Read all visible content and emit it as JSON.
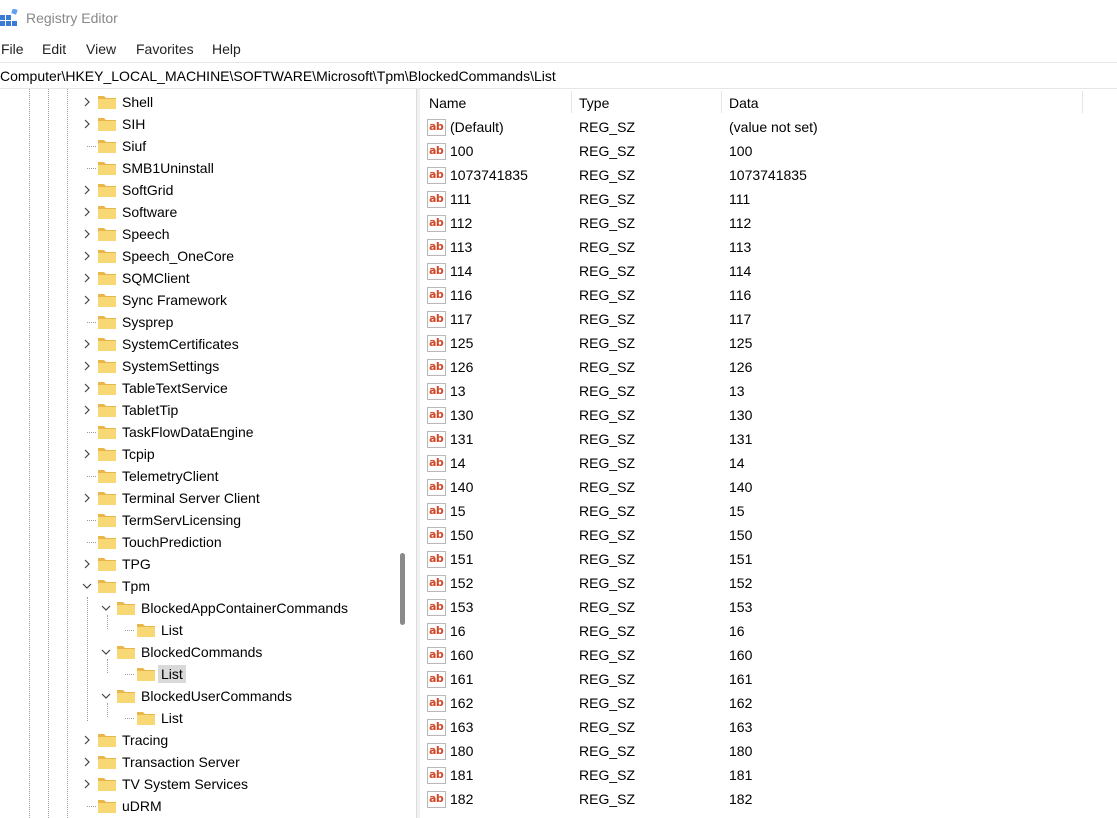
{
  "window": {
    "title": "Registry Editor"
  },
  "menu": [
    "File",
    "Edit",
    "View",
    "Favorites",
    "Help"
  ],
  "address": "Computer\\HKEY_LOCAL_MACHINE\\SOFTWARE\\Microsoft\\Tpm\\BlockedCommands\\List",
  "colors": {
    "folder": "#f8d775",
    "folder_dark": "#e8b64a",
    "ab_text": "#d24726",
    "selection": "#d9d9d9"
  },
  "tree": [
    {
      "label": "Shell",
      "chevron": "right"
    },
    {
      "label": "SIH",
      "chevron": "right"
    },
    {
      "label": "Siuf",
      "chevron": "none"
    },
    {
      "label": "SMB1Uninstall",
      "chevron": "none"
    },
    {
      "label": "SoftGrid",
      "chevron": "right"
    },
    {
      "label": "Software",
      "chevron": "right"
    },
    {
      "label": "Speech",
      "chevron": "right"
    },
    {
      "label": "Speech_OneCore",
      "chevron": "right"
    },
    {
      "label": "SQMClient",
      "chevron": "right"
    },
    {
      "label": "Sync Framework",
      "chevron": "right"
    },
    {
      "label": "Sysprep",
      "chevron": "none"
    },
    {
      "label": "SystemCertificates",
      "chevron": "right"
    },
    {
      "label": "SystemSettings",
      "chevron": "right"
    },
    {
      "label": "TableTextService",
      "chevron": "right"
    },
    {
      "label": "TabletTip",
      "chevron": "right"
    },
    {
      "label": "TaskFlowDataEngine",
      "chevron": "none"
    },
    {
      "label": "Tcpip",
      "chevron": "right"
    },
    {
      "label": "TelemetryClient",
      "chevron": "none"
    },
    {
      "label": "Terminal Server Client",
      "chevron": "right"
    },
    {
      "label": "TermServLicensing",
      "chevron": "none"
    },
    {
      "label": "TouchPrediction",
      "chevron": "none"
    },
    {
      "label": "TPG",
      "chevron": "right"
    },
    {
      "label": "Tpm",
      "chevron": "down"
    },
    {
      "label": "BlockedAppContainerCommands",
      "chevron": "down"
    },
    {
      "label": "List",
      "chevron": "none"
    },
    {
      "label": "BlockedCommands",
      "chevron": "down"
    },
    {
      "label": "List",
      "chevron": "none",
      "selected": true
    },
    {
      "label": "BlockedUserCommands",
      "chevron": "down"
    },
    {
      "label": "List",
      "chevron": "none"
    },
    {
      "label": "Tracing",
      "chevron": "right"
    },
    {
      "label": "Transaction Server",
      "chevron": "right"
    },
    {
      "label": "TV System Services",
      "chevron": "right"
    },
    {
      "label": "uDRM",
      "chevron": "none"
    }
  ],
  "columns": [
    "Name",
    "Type",
    "Data"
  ],
  "values": [
    {
      "name": "(Default)",
      "type": "REG_SZ",
      "data": "(value not set)"
    },
    {
      "name": "100",
      "type": "REG_SZ",
      "data": "100"
    },
    {
      "name": "1073741835",
      "type": "REG_SZ",
      "data": "1073741835"
    },
    {
      "name": "111",
      "type": "REG_SZ",
      "data": "111"
    },
    {
      "name": "112",
      "type": "REG_SZ",
      "data": "112"
    },
    {
      "name": "113",
      "type": "REG_SZ",
      "data": "113"
    },
    {
      "name": "114",
      "type": "REG_SZ",
      "data": "114"
    },
    {
      "name": "116",
      "type": "REG_SZ",
      "data": "116"
    },
    {
      "name": "117",
      "type": "REG_SZ",
      "data": "117"
    },
    {
      "name": "125",
      "type": "REG_SZ",
      "data": "125"
    },
    {
      "name": "126",
      "type": "REG_SZ",
      "data": "126"
    },
    {
      "name": "13",
      "type": "REG_SZ",
      "data": "13"
    },
    {
      "name": "130",
      "type": "REG_SZ",
      "data": "130"
    },
    {
      "name": "131",
      "type": "REG_SZ",
      "data": "131"
    },
    {
      "name": "14",
      "type": "REG_SZ",
      "data": "14"
    },
    {
      "name": "140",
      "type": "REG_SZ",
      "data": "140"
    },
    {
      "name": "15",
      "type": "REG_SZ",
      "data": "15"
    },
    {
      "name": "150",
      "type": "REG_SZ",
      "data": "150"
    },
    {
      "name": "151",
      "type": "REG_SZ",
      "data": "151"
    },
    {
      "name": "152",
      "type": "REG_SZ",
      "data": "152"
    },
    {
      "name": "153",
      "type": "REG_SZ",
      "data": "153"
    },
    {
      "name": "16",
      "type": "REG_SZ",
      "data": "16"
    },
    {
      "name": "160",
      "type": "REG_SZ",
      "data": "160"
    },
    {
      "name": "161",
      "type": "REG_SZ",
      "data": "161"
    },
    {
      "name": "162",
      "type": "REG_SZ",
      "data": "162"
    },
    {
      "name": "163",
      "type": "REG_SZ",
      "data": "163"
    },
    {
      "name": "180",
      "type": "REG_SZ",
      "data": "180"
    },
    {
      "name": "181",
      "type": "REG_SZ",
      "data": "181"
    },
    {
      "name": "182",
      "type": "REG_SZ",
      "data": "182"
    }
  ]
}
